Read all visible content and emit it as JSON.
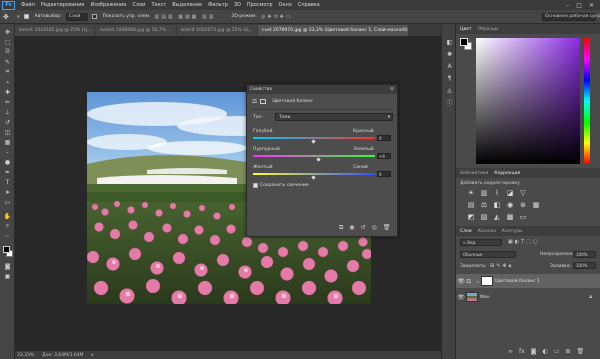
{
  "app": {
    "logo": "Ps",
    "menu": [
      "Файл",
      "Редактирование",
      "Изображение",
      "Слои",
      "Текст",
      "Выделение",
      "Фильтр",
      "3D",
      "Просмотр",
      "Окно",
      "Справка"
    ],
    "window_controls": [
      "–",
      "□",
      "✕"
    ]
  },
  "options": {
    "autoselect_label": "Автовыбор:",
    "autoselect_value": "Слой",
    "show_controls": "Показать упр. элем.",
    "mode3d": "3D-режим:",
    "workspace": "Основная рабочая среда"
  },
  "tabs": [
    {
      "label": "kolorit 1043185.jpg @ 25% (Ц...",
      "active": false
    },
    {
      "label": "kolorit 1048468.jpg @ 16,7% ...",
      "active": false
    },
    {
      "label": "kolorit 1001073.jpg @ 25% (Ц...",
      "active": false
    },
    {
      "label": "cvet 2076970.jpg @ 33,3% (Цветовой баланс 1, Слой-маска/8) *",
      "active": true
    }
  ],
  "status": {
    "zoom": "33,33%",
    "doc": "Док: 3,64M/3,64M"
  },
  "properties": {
    "title": "Свойства",
    "adjustment": "Цветовой баланс",
    "tone_label": "Тон:",
    "tone_value": "Тени",
    "sliders": [
      {
        "left": "Голубой",
        "right": "Красный",
        "value": "0",
        "gradient": [
          "#00c8ff",
          "#ff3030"
        ],
        "position": 0.5
      },
      {
        "left": "Пурпурный",
        "right": "Зеленый",
        "value": "+6",
        "gradient": [
          "#ff30ff",
          "#30ff30"
        ],
        "position": 0.54
      },
      {
        "left": "Желтый",
        "right": "Синий",
        "value": "0",
        "gradient": [
          "#ffff30",
          "#3050ff"
        ],
        "position": 0.5
      }
    ],
    "preserve": "Сохранить свечение"
  },
  "color_panel": {
    "tabs": [
      "Цвет",
      "Образцы"
    ]
  },
  "adjust_panel": {
    "tabs": [
      "Библиотеки",
      "Коррекция"
    ],
    "hint": "Добавить корректировку"
  },
  "layers_panel": {
    "tabs": [
      "Слои",
      "Каналы",
      "Контуры"
    ],
    "kind": "Вид",
    "blend": "Обычные",
    "opacity_label": "Непрозрачность:",
    "opacity": "100%",
    "lock_label": "Закрепить:",
    "fill_label": "Заливка:",
    "fill": "100%",
    "layers": [
      {
        "name": "Цветовой баланс 1",
        "selected": true
      },
      {
        "name": "Фон",
        "selected": false
      }
    ]
  },
  "colors": {
    "accent": "#31a8ff",
    "bg": "#535353",
    "panel": "#4a4a4a"
  }
}
